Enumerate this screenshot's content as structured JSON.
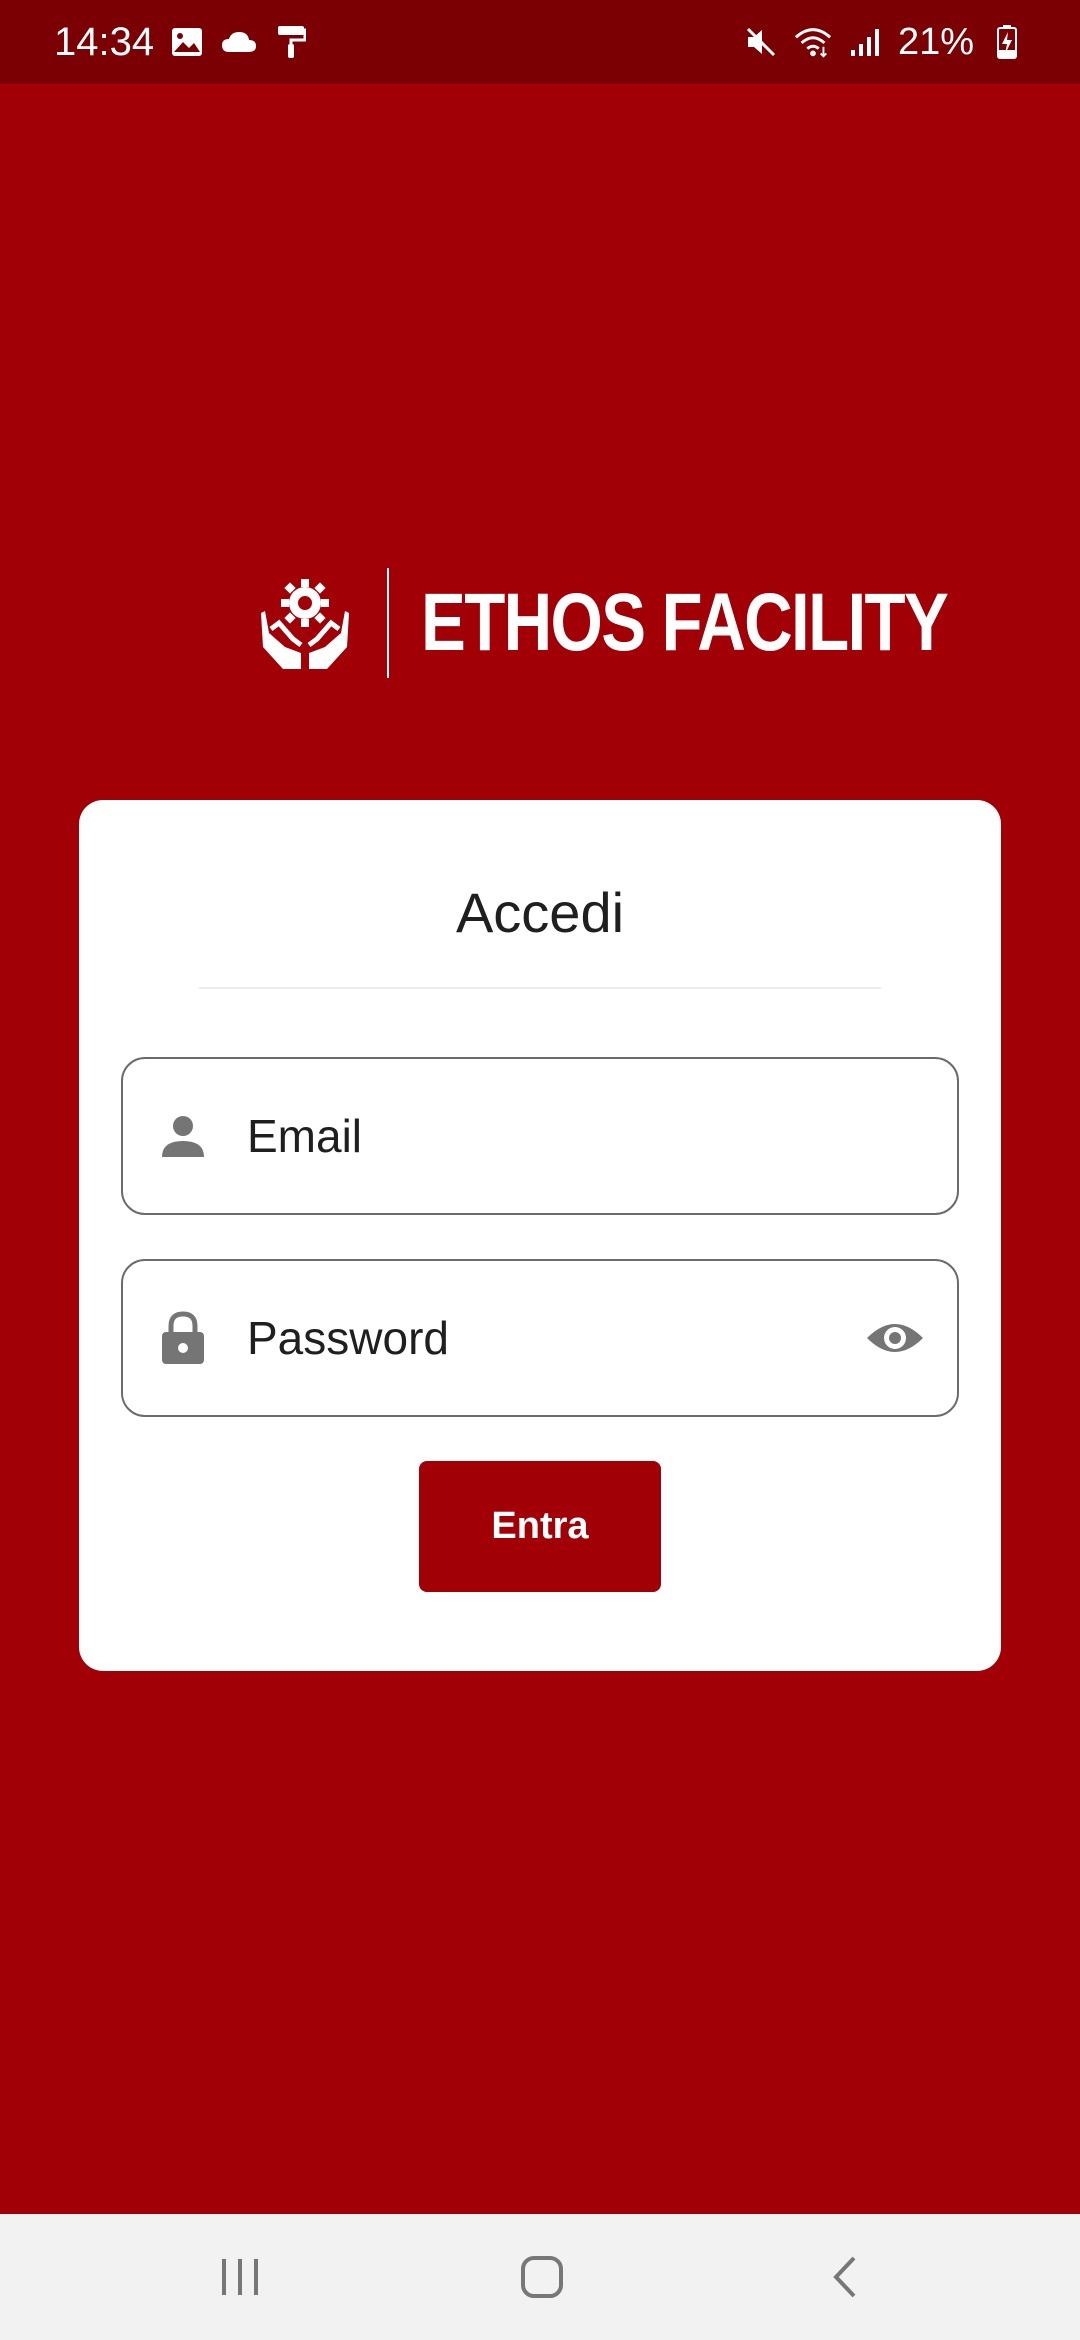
{
  "status_bar": {
    "time": "14:34",
    "battery_percent": "21%",
    "left_icons": [
      "gallery-icon",
      "cloud-icon",
      "paint-roller-icon"
    ],
    "right_icons": [
      "mute-icon",
      "wifi-icon",
      "signal-icon",
      "battery-charging-icon"
    ]
  },
  "logo": {
    "text": "ETHOS FACILITY",
    "emblem_icon": "hands-gear-icon"
  },
  "login_card": {
    "title": "Accedi",
    "email_placeholder": "Email",
    "email_value": "",
    "password_placeholder": "Password",
    "password_value": "",
    "submit_label": "Entra"
  },
  "nav_bar": {
    "buttons": [
      "recent-apps",
      "home",
      "back"
    ]
  },
  "colors": {
    "background": "#a00006",
    "status_bar": "#7a0004",
    "card": "#ffffff",
    "button": "#a00006",
    "field_border": "#6b6b6b",
    "icon_gray": "#757575",
    "nav_bar": "#f2f2f2"
  }
}
